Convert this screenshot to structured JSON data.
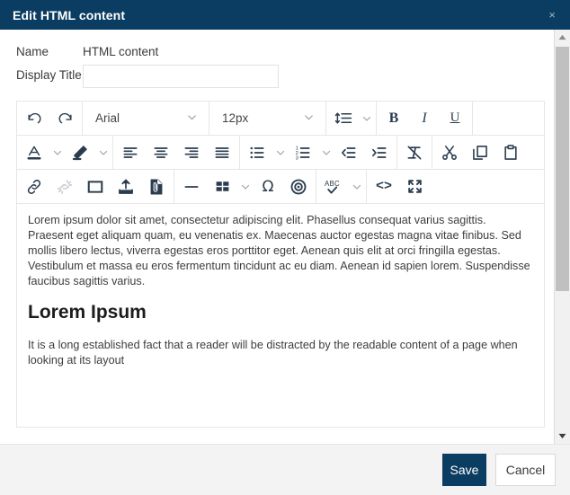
{
  "titlebar": {
    "title": "Edit HTML content",
    "close_label": "×"
  },
  "form": {
    "name_label": "Name",
    "name_value": "HTML content",
    "display_title_label": "Display Title",
    "display_title_value": "",
    "display_title_placeholder": ""
  },
  "toolbar": {
    "row1": {
      "undo": "undo-icon",
      "redo": "redo-icon",
      "font_family": "Arial",
      "font_size": "12px",
      "line_height": "line-height-icon",
      "bold": "B",
      "italic": "I",
      "underline": "U"
    },
    "row2": {
      "text_color": "A",
      "highlight": "highlight-icon",
      "align_left": "align-left-icon",
      "align_center": "align-center-icon",
      "align_right": "align-right-icon",
      "align_justify": "align-justify-icon",
      "bullet_list": "bullet-list-icon",
      "numbered_list": "numbered-list-icon",
      "outdent": "outdent-icon",
      "indent": "indent-icon",
      "clear_format": "clear-format-icon",
      "cut": "cut-icon",
      "copy": "copy-icon",
      "paste": "paste-icon"
    },
    "row3": {
      "link": "link-icon",
      "unlink": "unlink-icon",
      "image": "image-icon",
      "upload": "upload-icon",
      "attach_file": "attach-file-icon",
      "horizontal_rule": "horizontal-rule-icon",
      "table": "table-icon",
      "special_char": "Ω",
      "anchor": "anchor-target-icon",
      "spellcheck": "ABC",
      "source_code": "<>",
      "fullscreen": "fullscreen-icon"
    }
  },
  "content": {
    "paragraph1": "Lorem ipsum dolor sit amet, consectetur adipiscing elit. Phasellus consequat varius sagittis. Praesent eget aliquam quam, eu venenatis ex. Maecenas auctor egestas magna vitae finibus. Sed mollis libero lectus, viverra egestas eros porttitor eget. Aenean quis elit at orci fringilla egestas. Vestibulum et massa eu eros fermentum tincidunt ac eu diam. Aenean id sapien lorem. Suspendisse faucibus sagittis varius.",
    "heading": "Lorem Ipsum",
    "paragraph2": "It is a long established fact that a reader will be distracted by the readable content of a page when looking at its layout"
  },
  "footer": {
    "save_label": "Save",
    "cancel_label": "Cancel"
  },
  "colors": {
    "titlebar_bg": "#0b3c61",
    "save_bg": "#0b3c61",
    "footer_bg": "#f3f3f3",
    "icon": "#2b3c4e",
    "icon_disabled": "#c6ccd2"
  }
}
